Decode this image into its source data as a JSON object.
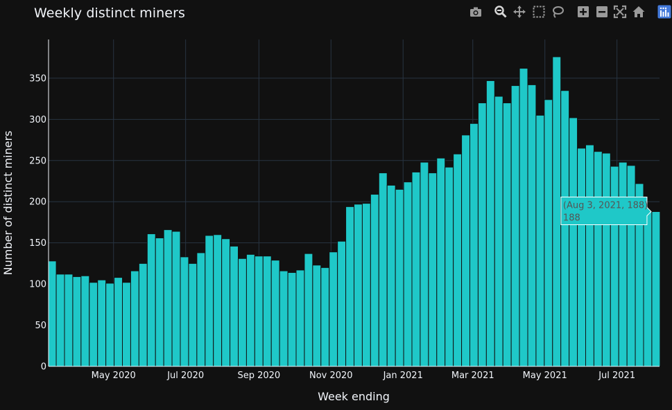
{
  "title": "Weekly distinct miners",
  "colors": {
    "background": "#111111",
    "bar": "#1fc8c8",
    "bar_outline": "#111111",
    "grid": "#283442",
    "text": "#f2f5fa",
    "modebar_icon": "#9a9a9a",
    "modebar_logo": "#447adb"
  },
  "modebar": [
    {
      "name": "camera-icon",
      "icon": "camera"
    },
    {
      "name": "zoom-icon",
      "icon": "magnifier"
    },
    {
      "name": "pan-icon",
      "icon": "cross-arrows"
    },
    {
      "name": "box-select-icon",
      "icon": "dashed-square"
    },
    {
      "name": "lasso-select-icon",
      "icon": "lasso"
    },
    {
      "name": "zoom-in-icon",
      "icon": "plus-square"
    },
    {
      "name": "zoom-out-icon",
      "icon": "minus-square"
    },
    {
      "name": "autoscale-icon",
      "icon": "expand-corners"
    },
    {
      "name": "reset-axes-icon",
      "icon": "home"
    },
    {
      "name": "plotly-logo-icon",
      "icon": "plotly-logo"
    }
  ],
  "chart_data": {
    "type": "bar",
    "title": "Weekly distinct miners",
    "xlabel": "Week ending",
    "ylabel": "Number of distinct miners",
    "ylim": [
      0,
      397
    ],
    "xlim": [
      "2020-03-07",
      "2021-08-06"
    ],
    "yticks": [
      0,
      50,
      100,
      150,
      200,
      250,
      300,
      350
    ],
    "xticks": [
      {
        "date": "2020-05-01",
        "label": "May 2020"
      },
      {
        "date": "2020-07-01",
        "label": "Jul 2020"
      },
      {
        "date": "2020-09-01",
        "label": "Sep 2020"
      },
      {
        "date": "2020-11-01",
        "label": "Nov 2020"
      },
      {
        "date": "2021-01-01",
        "label": "Jan 2021"
      },
      {
        "date": "2021-03-01",
        "label": "Mar 2021"
      },
      {
        "date": "2021-05-01",
        "label": "May 2021"
      },
      {
        "date": "2021-07-01",
        "label": "Jul 2021"
      }
    ],
    "x": [
      "2020-03-10",
      "2020-03-17",
      "2020-03-24",
      "2020-03-31",
      "2020-04-07",
      "2020-04-14",
      "2020-04-21",
      "2020-04-28",
      "2020-05-05",
      "2020-05-12",
      "2020-05-19",
      "2020-05-26",
      "2020-06-02",
      "2020-06-09",
      "2020-06-16",
      "2020-06-23",
      "2020-06-30",
      "2020-07-07",
      "2020-07-14",
      "2020-07-21",
      "2020-07-28",
      "2020-08-04",
      "2020-08-11",
      "2020-08-18",
      "2020-08-25",
      "2020-09-01",
      "2020-09-08",
      "2020-09-15",
      "2020-09-22",
      "2020-09-29",
      "2020-10-06",
      "2020-10-13",
      "2020-10-20",
      "2020-10-27",
      "2020-11-03",
      "2020-11-10",
      "2020-11-17",
      "2020-11-24",
      "2020-12-01",
      "2020-12-08",
      "2020-12-15",
      "2020-12-22",
      "2020-12-29",
      "2021-01-05",
      "2021-01-12",
      "2021-01-19",
      "2021-01-26",
      "2021-02-02",
      "2021-02-09",
      "2021-02-16",
      "2021-02-23",
      "2021-03-02",
      "2021-03-09",
      "2021-03-16",
      "2021-03-23",
      "2021-03-30",
      "2021-04-06",
      "2021-04-13",
      "2021-04-20",
      "2021-04-27",
      "2021-05-04",
      "2021-05-11",
      "2021-05-18",
      "2021-05-25",
      "2021-06-01",
      "2021-06-08",
      "2021-06-15",
      "2021-06-22",
      "2021-06-29",
      "2021-07-06",
      "2021-07-13",
      "2021-07-20",
      "2021-07-27",
      "2021-08-03"
    ],
    "values": [
      128,
      112,
      112,
      109,
      110,
      102,
      105,
      101,
      108,
      102,
      116,
      125,
      161,
      156,
      166,
      164,
      133,
      125,
      138,
      159,
      160,
      155,
      146,
      131,
      136,
      134,
      134,
      129,
      116,
      114,
      117,
      137,
      123,
      120,
      139,
      152,
      194,
      197,
      198,
      209,
      235,
      220,
      215,
      224,
      236,
      248,
      235,
      253,
      242,
      258,
      281,
      295,
      320,
      347,
      328,
      320,
      341,
      362,
      342,
      305,
      324,
      376,
      335,
      302,
      265,
      269,
      261,
      259,
      243,
      248,
      244,
      222,
      188,
      188
    ],
    "hover": {
      "index": 73,
      "line1": "(Aug 3, 2021, 188)",
      "line2": "188"
    }
  }
}
